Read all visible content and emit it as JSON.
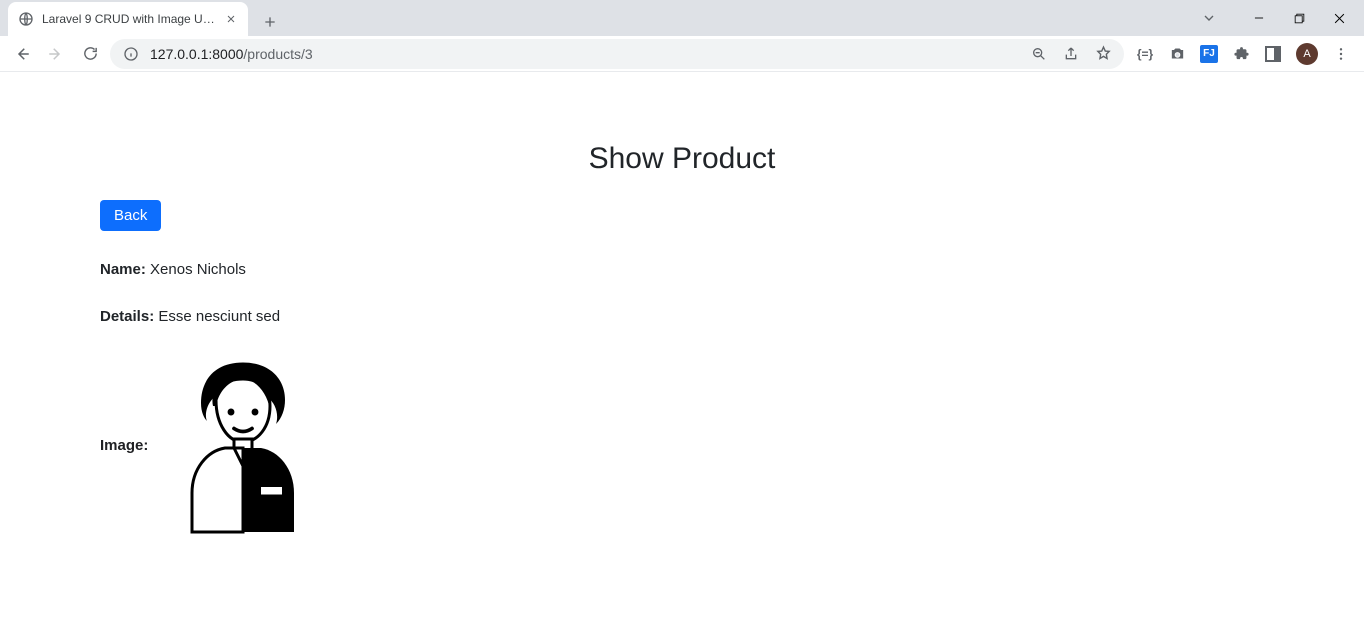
{
  "browser": {
    "tab_title": "Laravel 9 CRUD with Image Uploa",
    "url_host": "127.0.0.1:8000",
    "url_path": "/products/3",
    "avatar_letter": "A",
    "flash_badge": "FJ"
  },
  "page": {
    "heading": "Show Product",
    "back_label": "Back",
    "labels": {
      "name": "Name:",
      "details": "Details:",
      "image": "Image:"
    },
    "product": {
      "name": "Xenos Nichols",
      "details": "Esse nesciunt sed"
    }
  }
}
